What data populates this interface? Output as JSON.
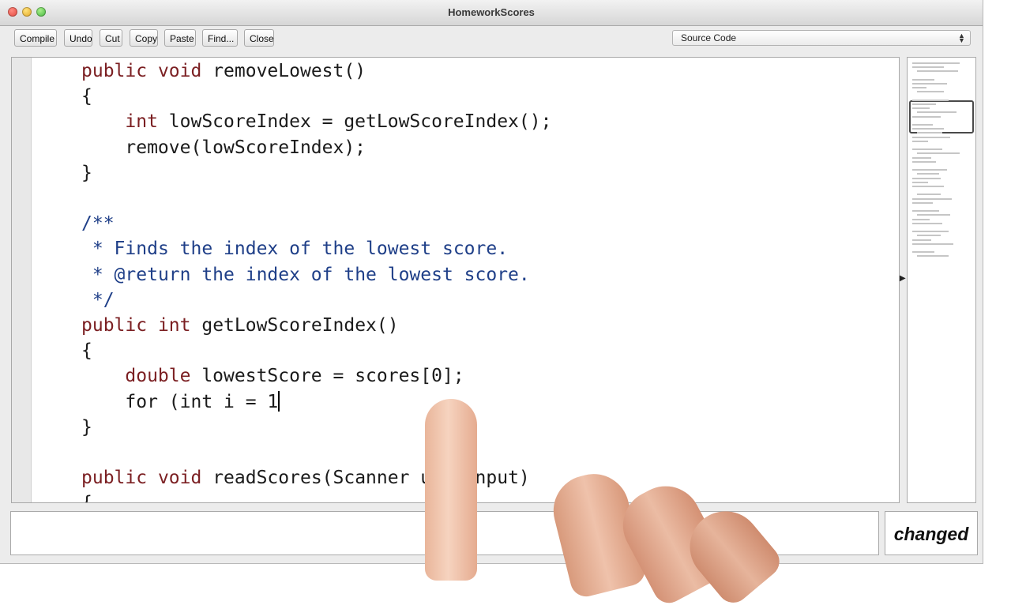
{
  "window": {
    "title": "HomeworkScores"
  },
  "toolbar": {
    "buttons": [
      "Compile",
      "Undo",
      "Cut",
      "Copy",
      "Paste",
      "Find...",
      "Close"
    ]
  },
  "view_select": {
    "selected": "Source Code"
  },
  "code": {
    "lines": [
      {
        "indent": "",
        "tokens": [
          [
            "public",
            "kw"
          ],
          [
            " "
          ],
          [
            "void",
            "kw"
          ],
          [
            " removeLowest()"
          ]
        ]
      },
      {
        "indent": "",
        "tokens": [
          [
            "{"
          ]
        ]
      },
      {
        "indent": "    ",
        "tokens": [
          [
            "int",
            "kw"
          ],
          [
            " lowScoreIndex = getLowScoreIndex();"
          ]
        ]
      },
      {
        "indent": "    ",
        "tokens": [
          [
            "remove(lowScoreIndex);"
          ]
        ]
      },
      {
        "indent": "",
        "tokens": [
          [
            "}"
          ]
        ]
      },
      {
        "indent": "",
        "tokens": []
      },
      {
        "indent": "",
        "tokens": [
          [
            "/**",
            "cm"
          ]
        ]
      },
      {
        "indent": " ",
        "tokens": [
          [
            "* Finds the index of the lowest score.",
            "cm"
          ]
        ]
      },
      {
        "indent": " ",
        "tokens": [
          [
            "* @return the index of the lowest score.",
            "cm"
          ]
        ]
      },
      {
        "indent": " ",
        "tokens": [
          [
            "*/",
            "cm"
          ]
        ]
      },
      {
        "indent": "",
        "tokens": [
          [
            "public",
            "kw"
          ],
          [
            " "
          ],
          [
            "int",
            "kw"
          ],
          [
            " getLowScoreIndex()"
          ]
        ]
      },
      {
        "indent": "",
        "tokens": [
          [
            "{"
          ]
        ]
      },
      {
        "indent": "    ",
        "tokens": [
          [
            "double",
            "kw"
          ],
          [
            " lowestScore = scores[0];"
          ]
        ]
      },
      {
        "indent": "    ",
        "tokens": [
          [
            "for (int i = 1"
          ]
        ],
        "caret": true
      },
      {
        "indent": "",
        "tokens": [
          [
            "}"
          ]
        ]
      },
      {
        "indent": "",
        "tokens": []
      },
      {
        "indent": "",
        "tokens": [
          [
            "public",
            "kw"
          ],
          [
            " "
          ],
          [
            "void",
            "kw"
          ],
          [
            " readScores(Scanner userInput)"
          ]
        ]
      },
      {
        "indent": "",
        "tokens": [
          [
            "{"
          ]
        ]
      }
    ]
  },
  "message_area": {
    "text": ""
  },
  "status": {
    "label": "changed"
  },
  "colors": {
    "keyword": "#7b1f22",
    "comment": "#1f3f88",
    "text": "#1b1b1b"
  }
}
